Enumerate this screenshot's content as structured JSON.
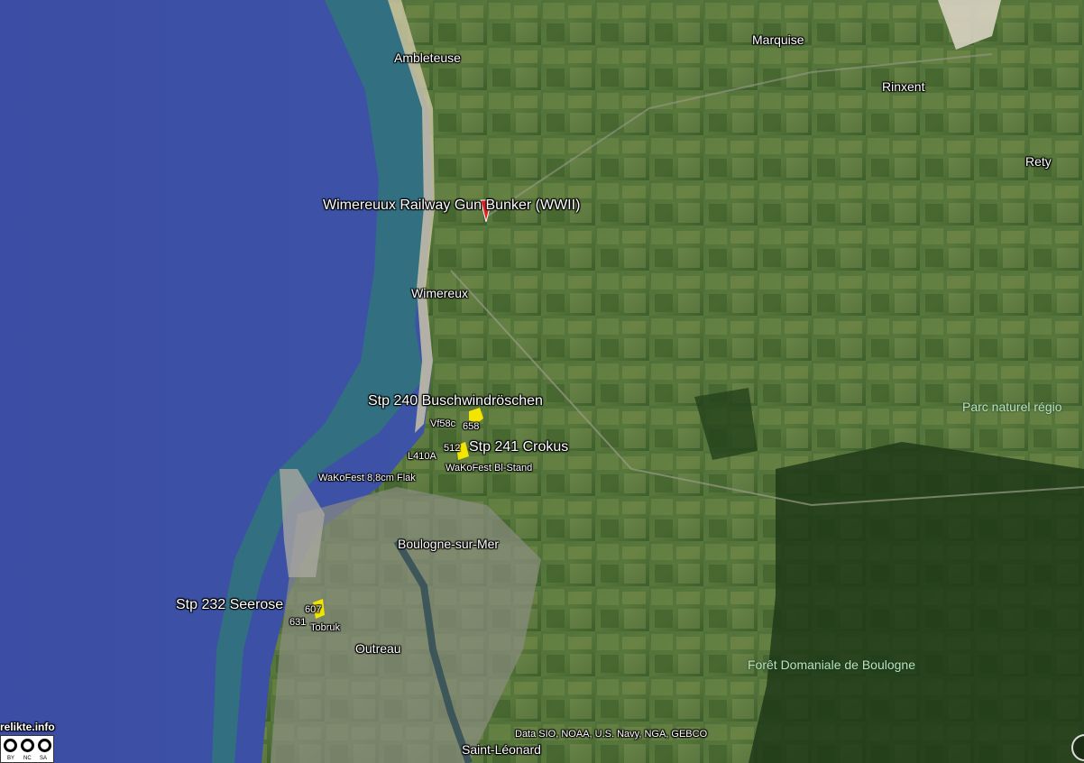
{
  "towns": [
    {
      "id": "ambleteuse",
      "label": "Ambleteuse"
    },
    {
      "id": "marquise",
      "label": "Marquise"
    },
    {
      "id": "rinxent",
      "label": "Rinxent"
    },
    {
      "id": "rety",
      "label": "Rety"
    },
    {
      "id": "wimereux",
      "label": "Wimereux"
    },
    {
      "id": "boulogne",
      "label": "Boulogne-sur-Mer"
    },
    {
      "id": "outreau",
      "label": "Outreau"
    },
    {
      "id": "saint-leonard",
      "label": "Saint-Léonard"
    }
  ],
  "places": {
    "parc": "Parc naturel régio",
    "foret": "Forêt Domaniale de Boulogne"
  },
  "pois": {
    "railway": "Wimereuux Railway Gun Bunker (WWII)",
    "stp240": "Stp 240 Buschwindröschen",
    "stp241": "Stp 241 Crokus",
    "stp232": "Stp 232 Seerose"
  },
  "small_labels": {
    "vf58c": "Vf58c",
    "n658": "658",
    "n512": "512",
    "l410a": "L410A",
    "wakofest_bl": "WaKoFest Bl-Stand",
    "wakofest_flak": "WaKoFest 8,8cm Flak",
    "n607": "607",
    "n631": "631",
    "tobruk": "Tobruk"
  },
  "attribution": "Data SIO, NOAA, U.S. Navy, NGA, GEBCO",
  "credit": "relikte.info",
  "license": {
    "by": "BY",
    "nc": "NC",
    "sa": "SA"
  },
  "colors": {
    "sea": "#3e4fa6",
    "land": "#4a6b30",
    "forest": "#1f3a17",
    "marker": "#e02020",
    "highlight": "#f2e600"
  }
}
